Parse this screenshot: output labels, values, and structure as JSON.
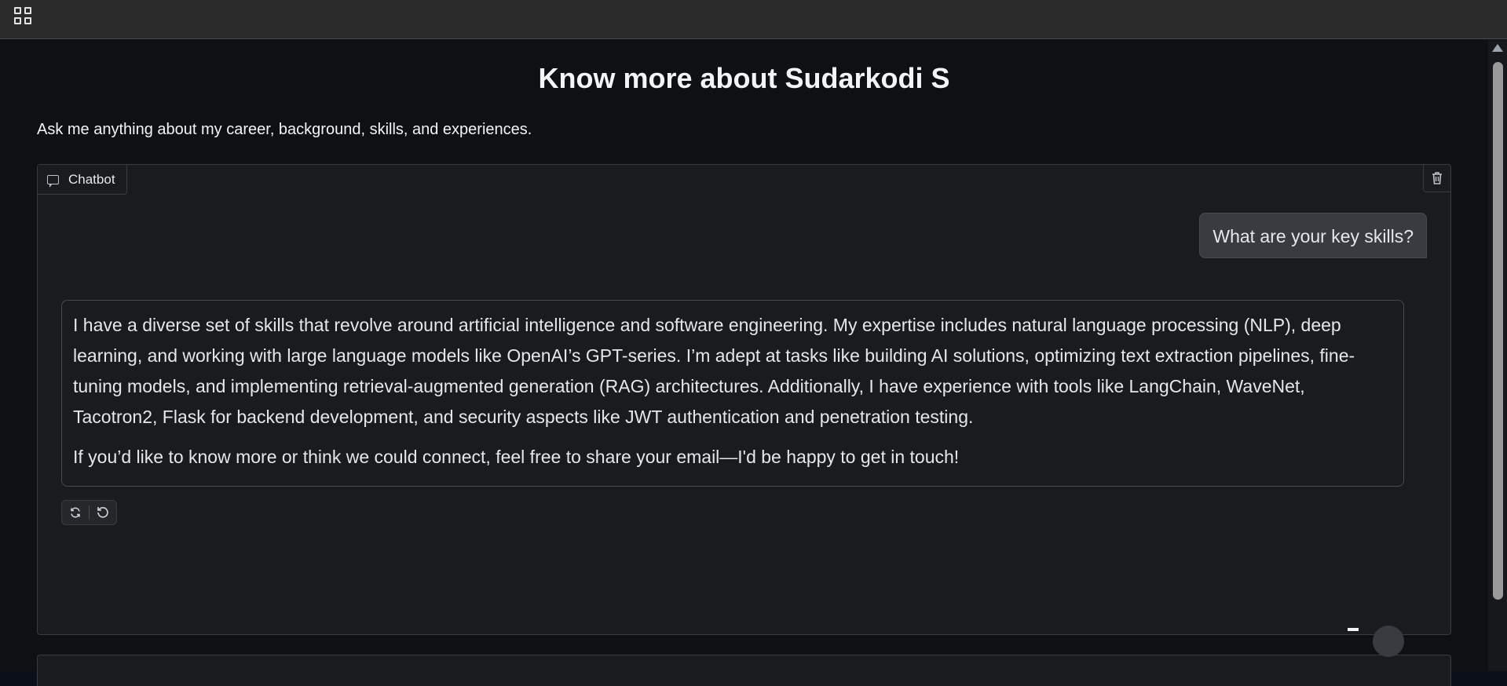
{
  "topbar": {
    "apps_icon": "grid-icon"
  },
  "page": {
    "title": "Know more about Sudarkodi S",
    "description": "Ask me anything about my career, background, skills, and experiences."
  },
  "chatbot": {
    "label": "Chatbot",
    "label_icon": "chat-icon",
    "clear_icon": "trash-icon",
    "messages": [
      {
        "role": "user",
        "text": "What are your key skills?"
      },
      {
        "role": "assistant",
        "paragraphs": [
          "I have a diverse set of skills that revolve around artificial intelligence and software engineering. My expertise includes natural language processing (NLP), deep learning, and working with large language models like OpenAI’s GPT-series. I’m adept at tasks like building AI solutions, optimizing text extraction pipelines, fine-tuning models, and implementing retrieval-augmented generation (RAG) architectures. Additionally, I have experience with tools like LangChain, WaveNet, Tacotron2, Flask for backend development, and security aspects like JWT authentication and penetration testing.",
          "If you’d like to know more or think we could connect, feel free to share your email—I'd be happy to get in touch!"
        ]
      }
    ],
    "actions": [
      {
        "icon": "retry-icon"
      },
      {
        "icon": "undo-icon"
      }
    ]
  }
}
